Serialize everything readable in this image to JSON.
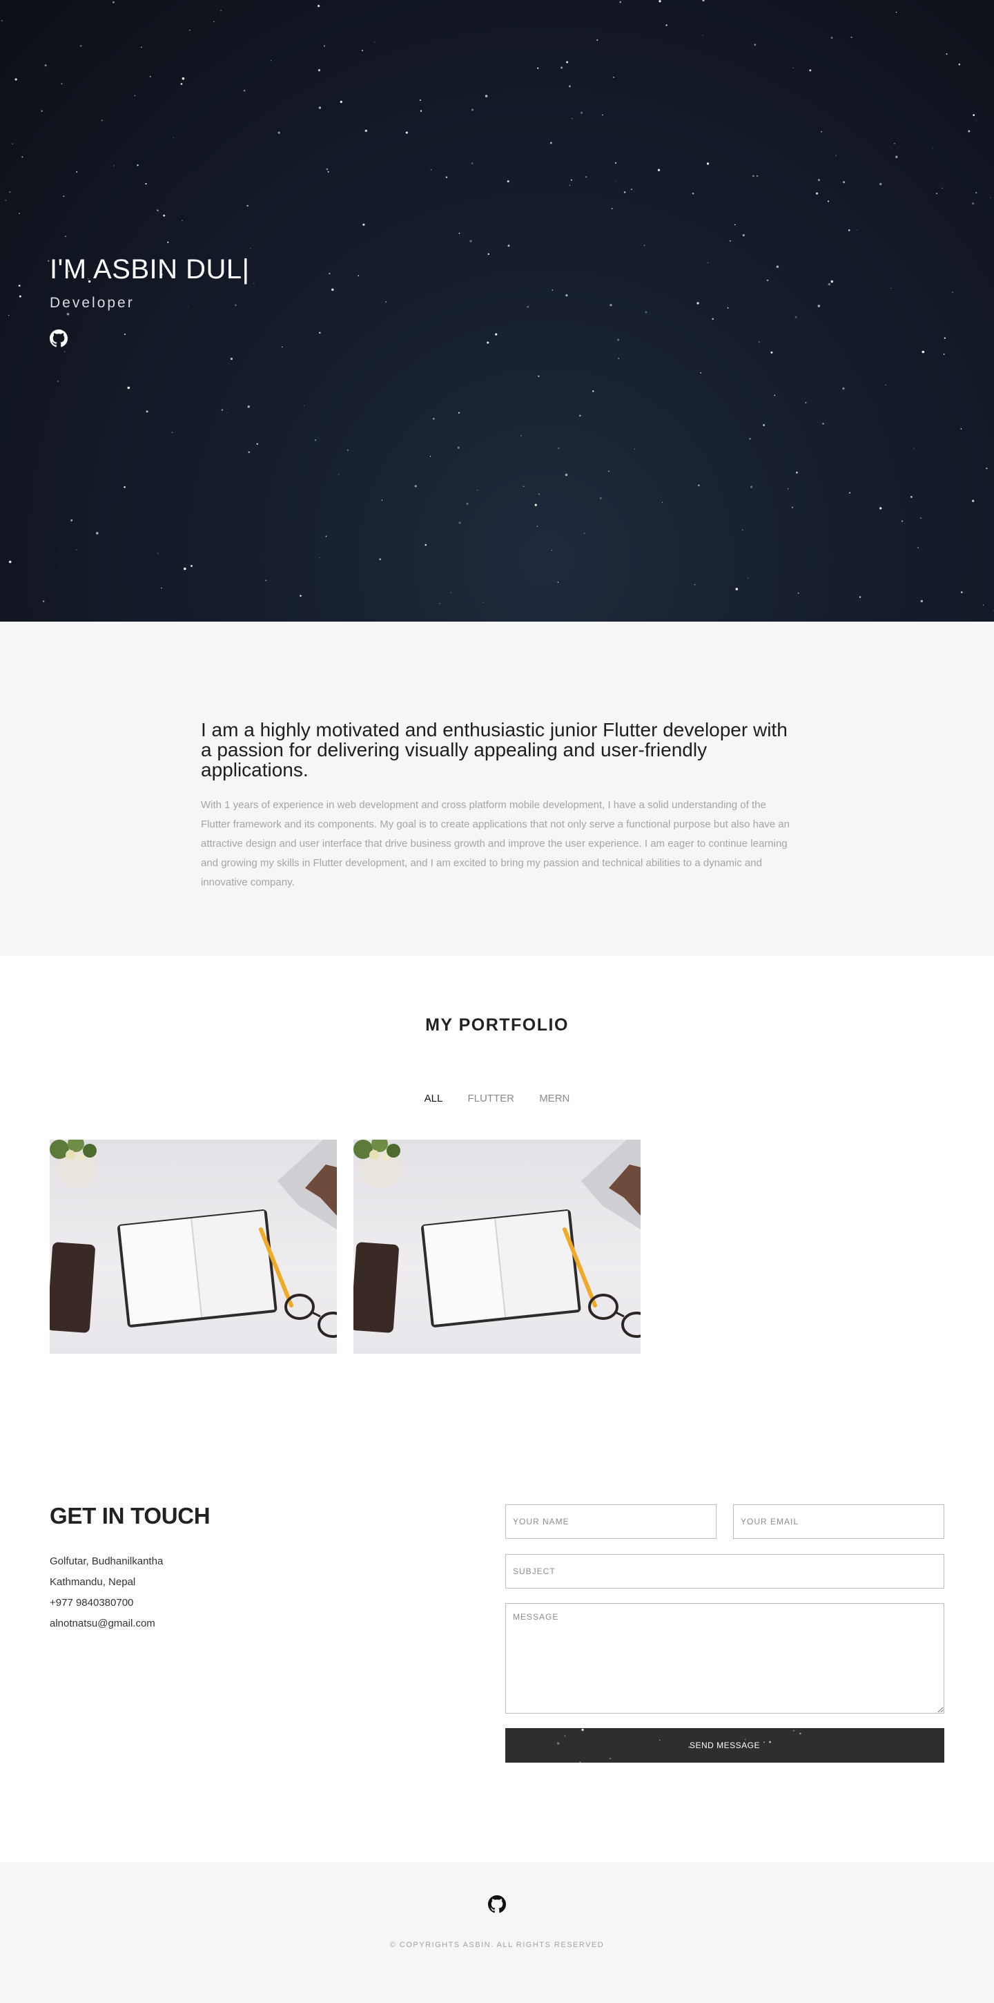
{
  "hero": {
    "title": "I'M ASBIN DUL|",
    "subtitle": "Developer",
    "github_icon": "github-icon"
  },
  "about": {
    "heading": "I am a highly motivated and enthusiastic junior Flutter developer with a passion for delivering visually appealing and user-friendly applications.",
    "text": "With 1 years of experience in web development and cross platform mobile development, I have a solid understanding of the Flutter framework and its components. My goal is to create applications that not only serve a functional purpose but also have an attractive design and user interface that drive business growth and improve the user experience. I am eager to continue learning and growing my skills in Flutter development, and I am excited to bring my passion and technical abilities to a dynamic and innovative company."
  },
  "portfolio": {
    "title": "MY PORTFOLIO",
    "filters": [
      "ALL",
      "FLUTTER",
      "MERN"
    ],
    "active_filter": "ALL"
  },
  "contact": {
    "title": "GET IN TOUCH",
    "address_line1": "Golfutar, Budhanilkantha",
    "address_line2": "Kathmandu, Nepal",
    "phone": "+977 9840380700",
    "email": "alnotnatsu@gmail.com",
    "form": {
      "name_placeholder": "YOUR NAME",
      "email_placeholder": "YOUR EMAIL",
      "subject_placeholder": "SUBJECT",
      "message_placeholder": "MESSAGE",
      "send_label": "SEND MESSAGE"
    }
  },
  "footer": {
    "copyright": "© COPYRIGHTS ASBIN. ALL RIGHTS RESERVED",
    "github_icon": "github-icon"
  },
  "colors": {
    "hero_dark": "#0c0f16",
    "hero_light": "#1e2a3c",
    "section_gray": "#f6f6f6",
    "button_dark": "#2e2e2e"
  }
}
